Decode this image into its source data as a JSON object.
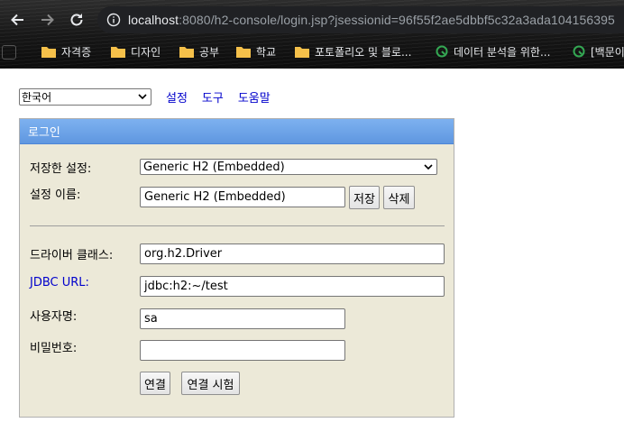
{
  "browser": {
    "url_host": "localhost",
    "url_path": ":8080/h2-console/login.jsp?jsessionid=96f55f2ae5dbbf5c32a3ada104156395",
    "bookmarks": [
      {
        "label": "자격증",
        "icon": "folder-icon"
      },
      {
        "label": "디자인",
        "icon": "folder-icon"
      },
      {
        "label": "공부",
        "icon": "folder-icon"
      },
      {
        "label": "학교",
        "icon": "folder-icon"
      },
      {
        "label": "포토폴리오 및 블로...",
        "icon": "folder-icon"
      },
      {
        "label": "데이터 분석을 위한...",
        "icon": "globe-icon"
      },
      {
        "label": "[백문이",
        "icon": "globe-icon"
      }
    ],
    "colors": {
      "bookmark_folder": "#f5c04a",
      "favicon": "#34a853"
    }
  },
  "top": {
    "language": "한국어",
    "links": [
      "설정",
      "도구",
      "도움말"
    ]
  },
  "login": {
    "header": "로그인",
    "saved_settings_label": "저장한 설정:",
    "saved_settings_value": "Generic H2 (Embedded)",
    "setting_name_label": "설정 이름:",
    "setting_name_value": "Generic H2 (Embedded)",
    "save_button": "저장",
    "delete_button": "삭제",
    "driver_class_label": "드라이버 클래스:",
    "driver_class_value": "org.h2.Driver",
    "jdbc_url_label": "JDBC URL:",
    "jdbc_url_value": "jdbc:h2:~/test",
    "username_label": "사용자명:",
    "username_value": "sa",
    "password_label": "비밀번호:",
    "password_value": "",
    "connect_button": "연결",
    "test_connection_button": "연결 시험"
  },
  "colors": {
    "panel_bg": "#ece9d8",
    "panel_header": "#6fa5ea",
    "link": "#0000cc"
  }
}
